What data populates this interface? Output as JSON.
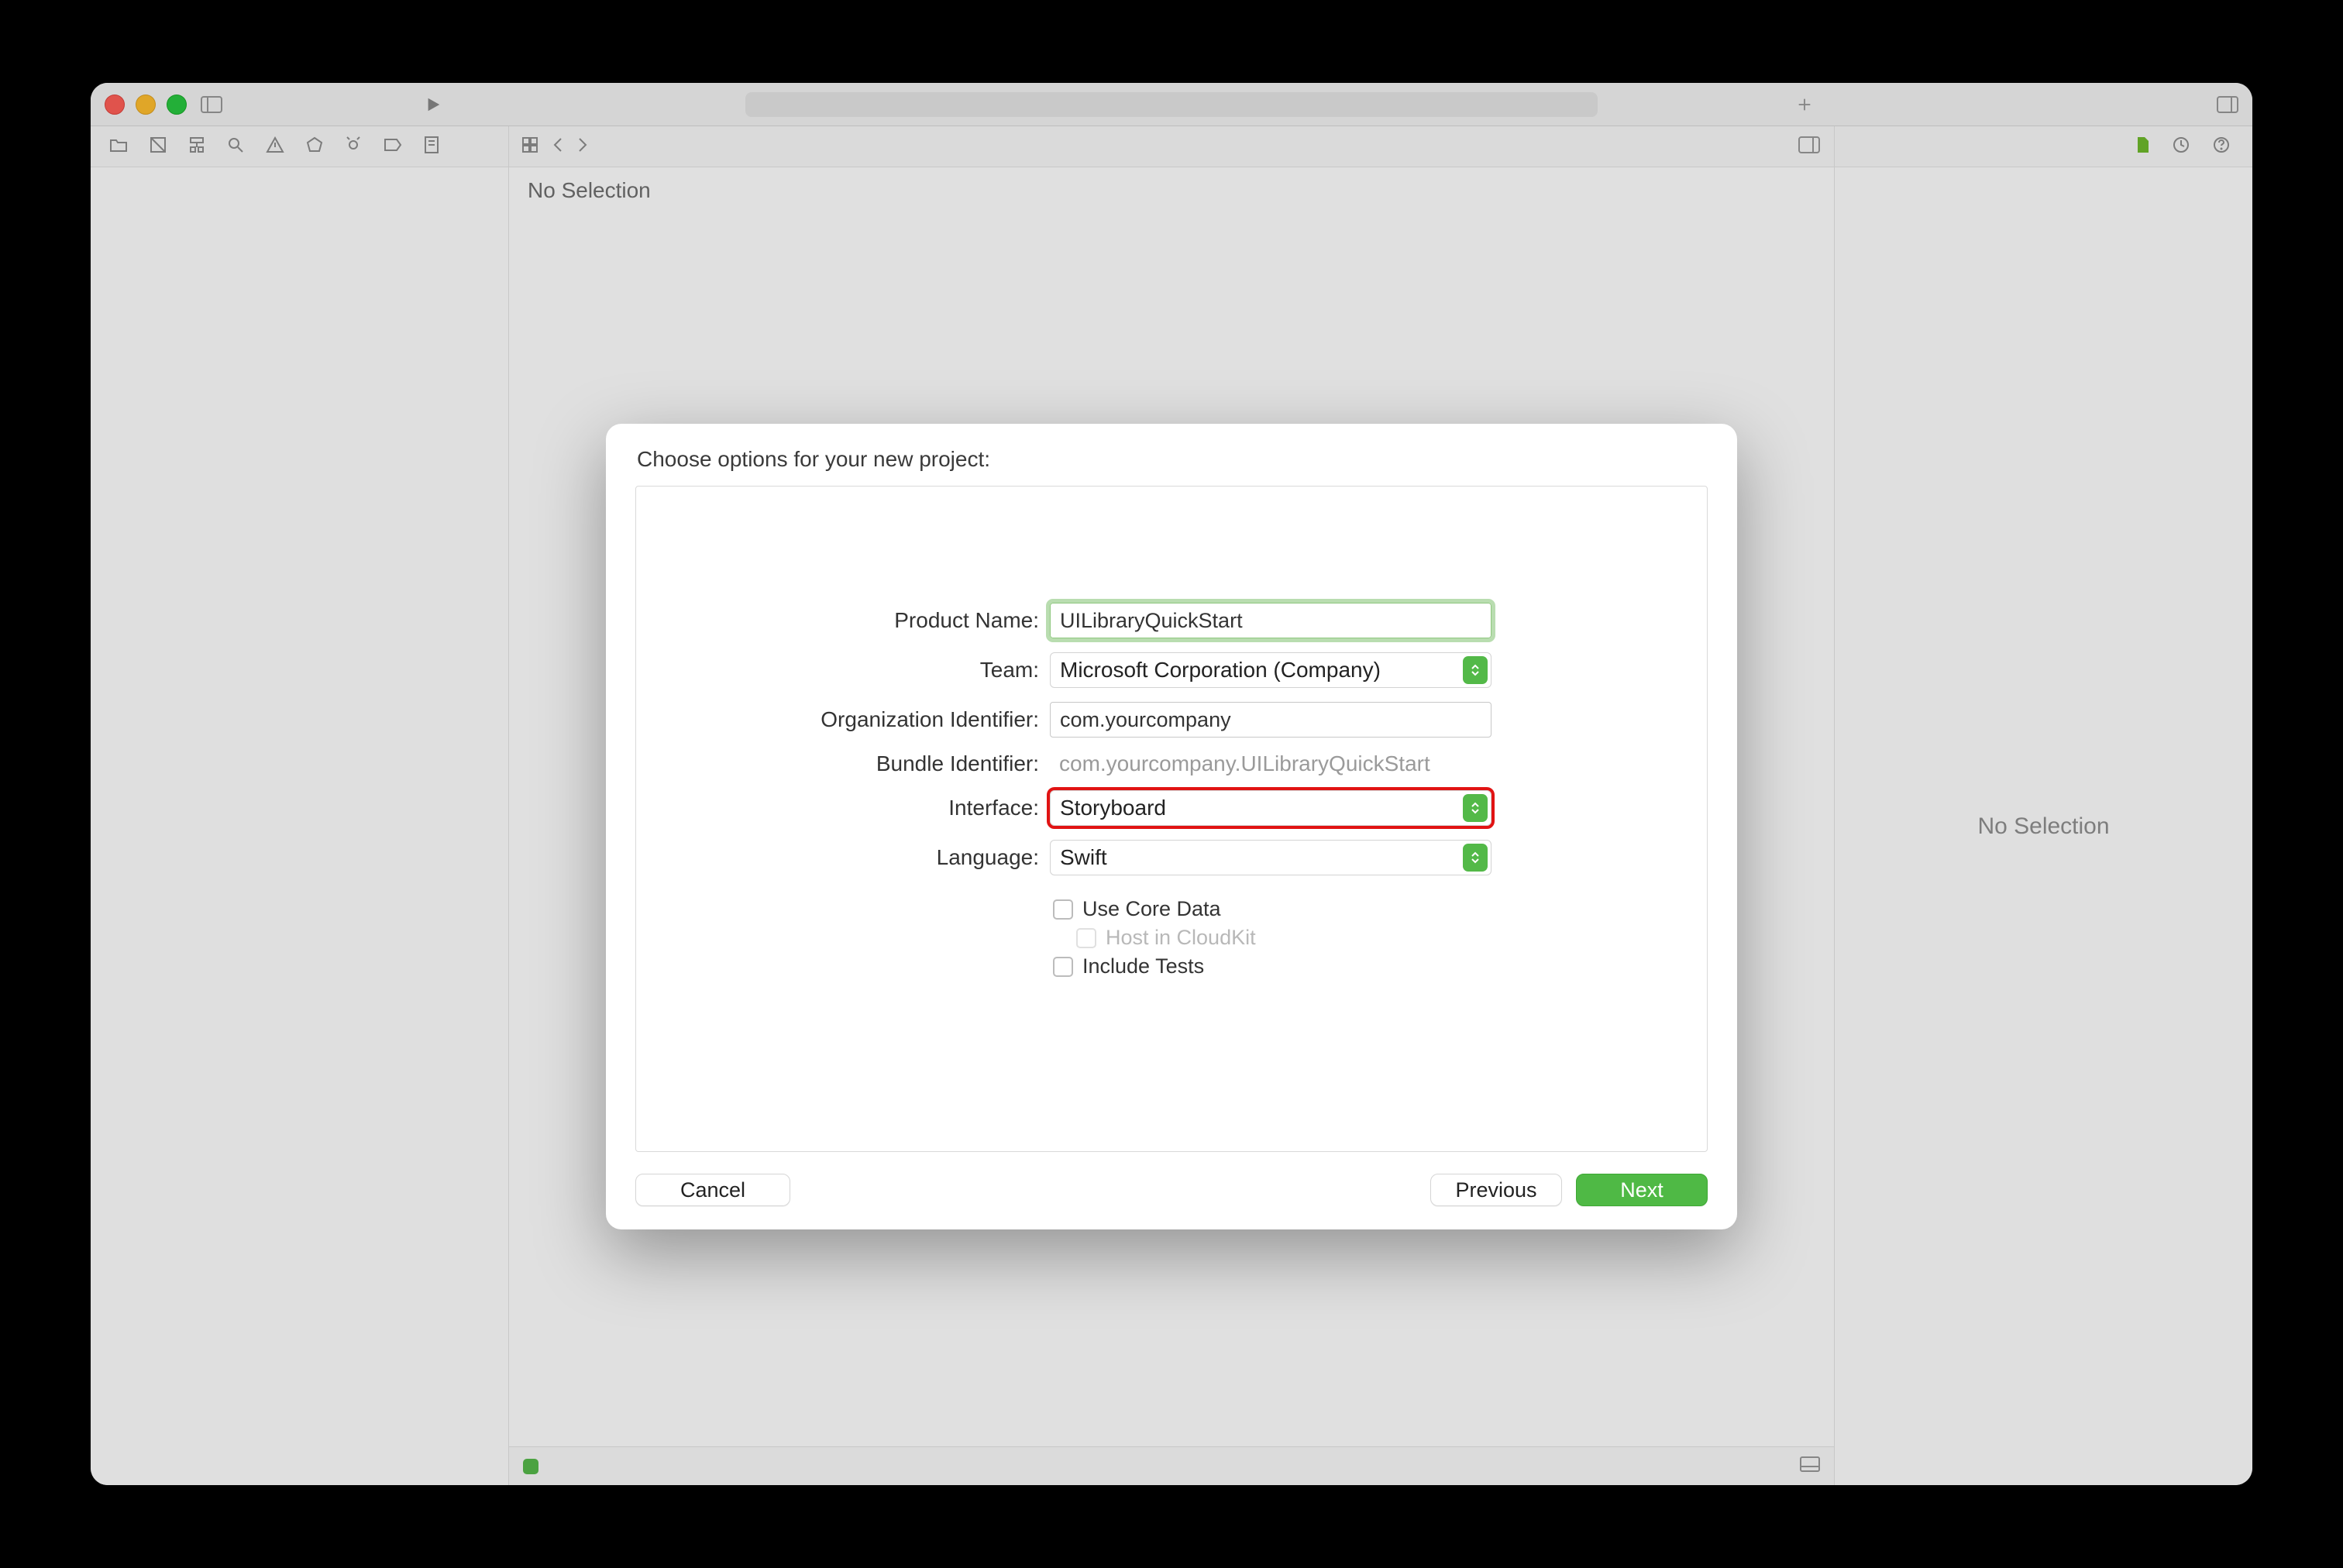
{
  "editor": {
    "crumb": "No Selection"
  },
  "inspector": {
    "empty": "No Selection"
  },
  "sheet": {
    "title": "Choose options for your new project:",
    "productNameLabel": "Product Name:",
    "productNameValue": "UILibraryQuickStart",
    "teamLabel": "Team:",
    "teamValue": "Microsoft Corporation (Company)",
    "orgIdLabel": "Organization Identifier:",
    "orgIdValue": "com.yourcompany",
    "bundleIdLabel": "Bundle Identifier:",
    "bundleIdValue": "com.yourcompany.UILibraryQuickStart",
    "interfaceLabel": "Interface:",
    "interfaceValue": "Storyboard",
    "languageLabel": "Language:",
    "languageValue": "Swift",
    "useCoreData": "Use Core Data",
    "hostCloudKit": "Host in CloudKit",
    "includeTests": "Include Tests",
    "cancel": "Cancel",
    "previous": "Previous",
    "next": "Next"
  }
}
